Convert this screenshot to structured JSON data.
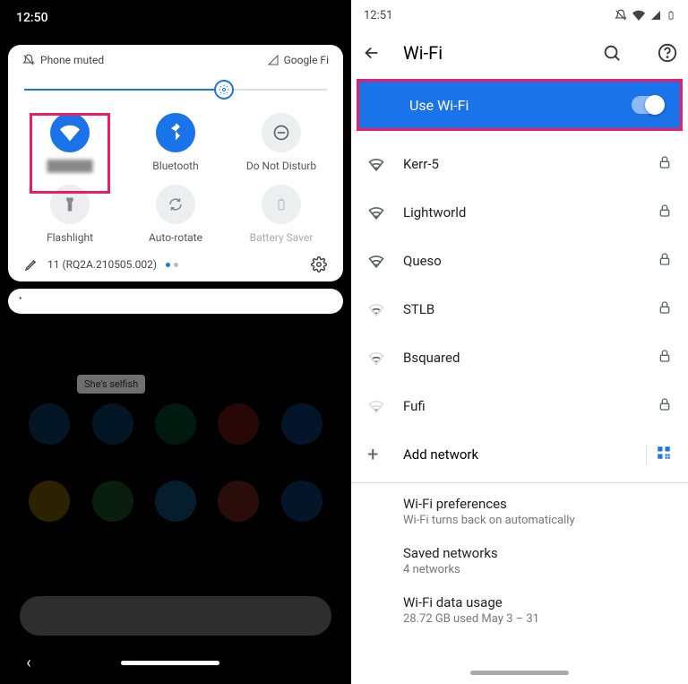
{
  "left": {
    "time": "12:50",
    "phone_muted": "Phone muted",
    "carrier": "Google Fi",
    "slider_pct": 66,
    "tiles": [
      {
        "id": "wifi",
        "label": "",
        "active": true
      },
      {
        "id": "bluetooth",
        "label": "Bluetooth",
        "active": true
      },
      {
        "id": "dnd",
        "label": "Do Not Disturb",
        "active": false
      },
      {
        "id": "flashlight",
        "label": "Flashlight",
        "active": false
      },
      {
        "id": "autorotate",
        "label": "Auto-rotate",
        "active": false
      },
      {
        "id": "battery",
        "label": "Battery Saver",
        "active": false
      }
    ],
    "build": "11 (RQ2A.210505.002)",
    "bubble": "She's selfish"
  },
  "right": {
    "time": "12:51",
    "title": "Wi-Fi",
    "toggle_label": "Use Wi-Fi",
    "networks": [
      {
        "name": "Kerr-5",
        "strength": 3,
        "locked": true
      },
      {
        "name": "Lightworld",
        "strength": 3,
        "locked": true
      },
      {
        "name": "Queso",
        "strength": 3,
        "locked": true
      },
      {
        "name": "STLB",
        "strength": 2,
        "locked": true
      },
      {
        "name": "Bsquared",
        "strength": 2,
        "locked": true
      },
      {
        "name": "Fufi",
        "strength": 1,
        "locked": true
      }
    ],
    "add_network": "Add network",
    "prefs": [
      {
        "title": "Wi-Fi preferences",
        "sub": "Wi-Fi turns back on automatically"
      },
      {
        "title": "Saved networks",
        "sub": "4 networks"
      },
      {
        "title": "Wi-Fi data usage",
        "sub": "28.72 GB used May 3 – 31"
      }
    ]
  }
}
